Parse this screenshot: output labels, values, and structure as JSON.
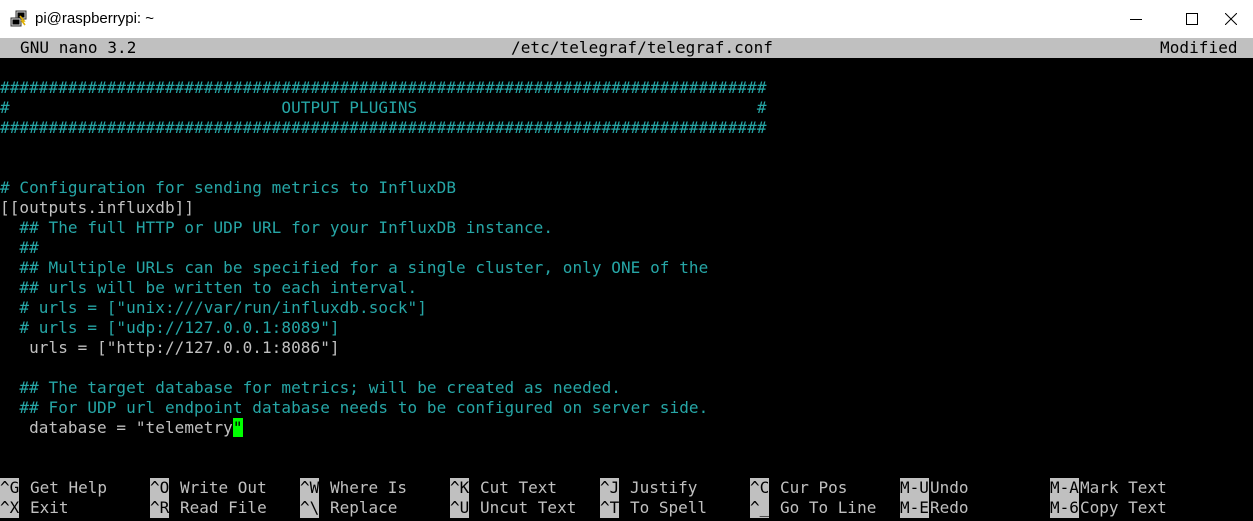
{
  "window": {
    "title": "pi@raspberrypi: ~",
    "icon": "putty-icon",
    "controls": [
      "minimize-icon",
      "maximize-icon",
      "close-icon"
    ]
  },
  "nano": {
    "version": "GNU nano 3.2",
    "filename": "/etc/telegraf/telegraf.conf",
    "state": "Modified"
  },
  "editor": {
    "lines": [
      "###############################################################################",
      "#                            OUTPUT PLUGINS                                   #",
      "###############################################################################",
      "",
      "",
      "# Configuration for sending metrics to InfluxDB",
      "[[outputs.influxdb]]",
      "  ## The full HTTP or UDP URL for your InfluxDB instance.",
      "  ##",
      "  ## Multiple URLs can be specified for a single cluster, only ONE of the",
      "  ## urls will be written to each interval.",
      "  # urls = [\"unix:///var/run/influxdb.sock\"]",
      "  # urls = [\"udp://127.0.0.1:8089\"]",
      "   urls = [\"http://127.0.0.1:8086\"]",
      "",
      "  ## The target database for metrics; will be created as needed.",
      "  ## For UDP url endpoint database needs to be configured on server side.",
      "   database = \"telemetry",
      "\""
    ]
  },
  "shortcuts": {
    "row1": [
      {
        "key": "^G",
        "label": "Get Help"
      },
      {
        "key": "^O",
        "label": "Write Out"
      },
      {
        "key": "^W",
        "label": "Where Is"
      },
      {
        "key": "^K",
        "label": "Cut Text"
      },
      {
        "key": "^J",
        "label": "Justify"
      },
      {
        "key": "^C",
        "label": "Cur Pos"
      },
      {
        "key": "M-U",
        "label": "Undo"
      },
      {
        "key": "M-A",
        "label": "Mark Text"
      }
    ],
    "row2": [
      {
        "key": "^X",
        "label": "Exit"
      },
      {
        "key": "^R",
        "label": "Read File"
      },
      {
        "key": "^\\",
        "label": "Replace"
      },
      {
        "key": "^U",
        "label": "Uncut Text"
      },
      {
        "key": "^T",
        "label": "To Spell"
      },
      {
        "key": "^_",
        "label": "Go To Line"
      },
      {
        "key": "M-E",
        "label": "Redo"
      },
      {
        "key": "M-6",
        "label": "Copy Text"
      }
    ]
  },
  "colors": {
    "comment": "#26a6a6",
    "text": "#c0c0c0",
    "cursor": "#00ff00",
    "background": "#000000",
    "status_bar": "#c0c0c0"
  }
}
